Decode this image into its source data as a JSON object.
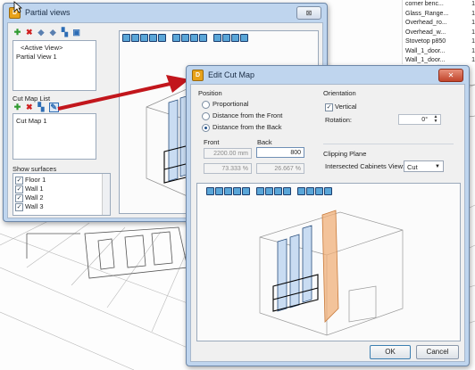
{
  "right_list": {
    "items": [
      {
        "name": "corner benc...",
        "count": "1"
      },
      {
        "name": "Glass_Range...",
        "count": "1"
      },
      {
        "name": "Overhead_ro...",
        "count": "1"
      },
      {
        "name": "Overhead_w...",
        "count": "1"
      },
      {
        "name": "Stovetop p850",
        "count": "1"
      },
      {
        "name": "Wall_1_door...",
        "count": "1"
      },
      {
        "name": "Wall_1_door...",
        "count": "1"
      }
    ]
  },
  "partial_views": {
    "title": "Partial views",
    "icon_letter": "D",
    "views": [
      "<Active View>",
      "Partial View 1"
    ],
    "cut_map_list_label": "Cut Map List",
    "cut_maps": [
      "Cut Map 1"
    ],
    "show_surfaces_label": "Show surfaces",
    "surfaces": [
      {
        "label": "Floor 1",
        "checked": true
      },
      {
        "label": "Wall 1",
        "checked": true
      },
      {
        "label": "Wall 2",
        "checked": true
      },
      {
        "label": "Wall 3",
        "checked": true
      }
    ],
    "close_glyph": "⊠"
  },
  "edit_cut_map": {
    "title": "Edit Cut Map",
    "icon_letter": "D",
    "close_glyph": "✕",
    "position": {
      "label": "Position",
      "options": [
        {
          "label": "Proportional",
          "selected": false
        },
        {
          "label": "Distance from the Front",
          "selected": false
        },
        {
          "label": "Distance from the Back",
          "selected": true
        }
      ],
      "front_label": "Front",
      "back_label": "Back",
      "front_value": "2200.00 mm",
      "back_value": "800",
      "front_percent": "73.333 %",
      "back_percent": "26.667 %"
    },
    "orientation": {
      "label": "Orientation",
      "vertical_label": "Vertical",
      "vertical_checked": true,
      "rotation_label": "Rotation:",
      "rotation_value": "0°"
    },
    "clipping": {
      "label": "Clipping Plane",
      "intersected_label": "Intersected Cabinets View:",
      "intersected_value": "Cut"
    },
    "ok_label": "OK",
    "cancel_label": "Cancel"
  },
  "colors": {
    "accent_arrow": "#c2161c",
    "window_frame": "#bfd5ee",
    "cut_plane": "#f0a868"
  }
}
